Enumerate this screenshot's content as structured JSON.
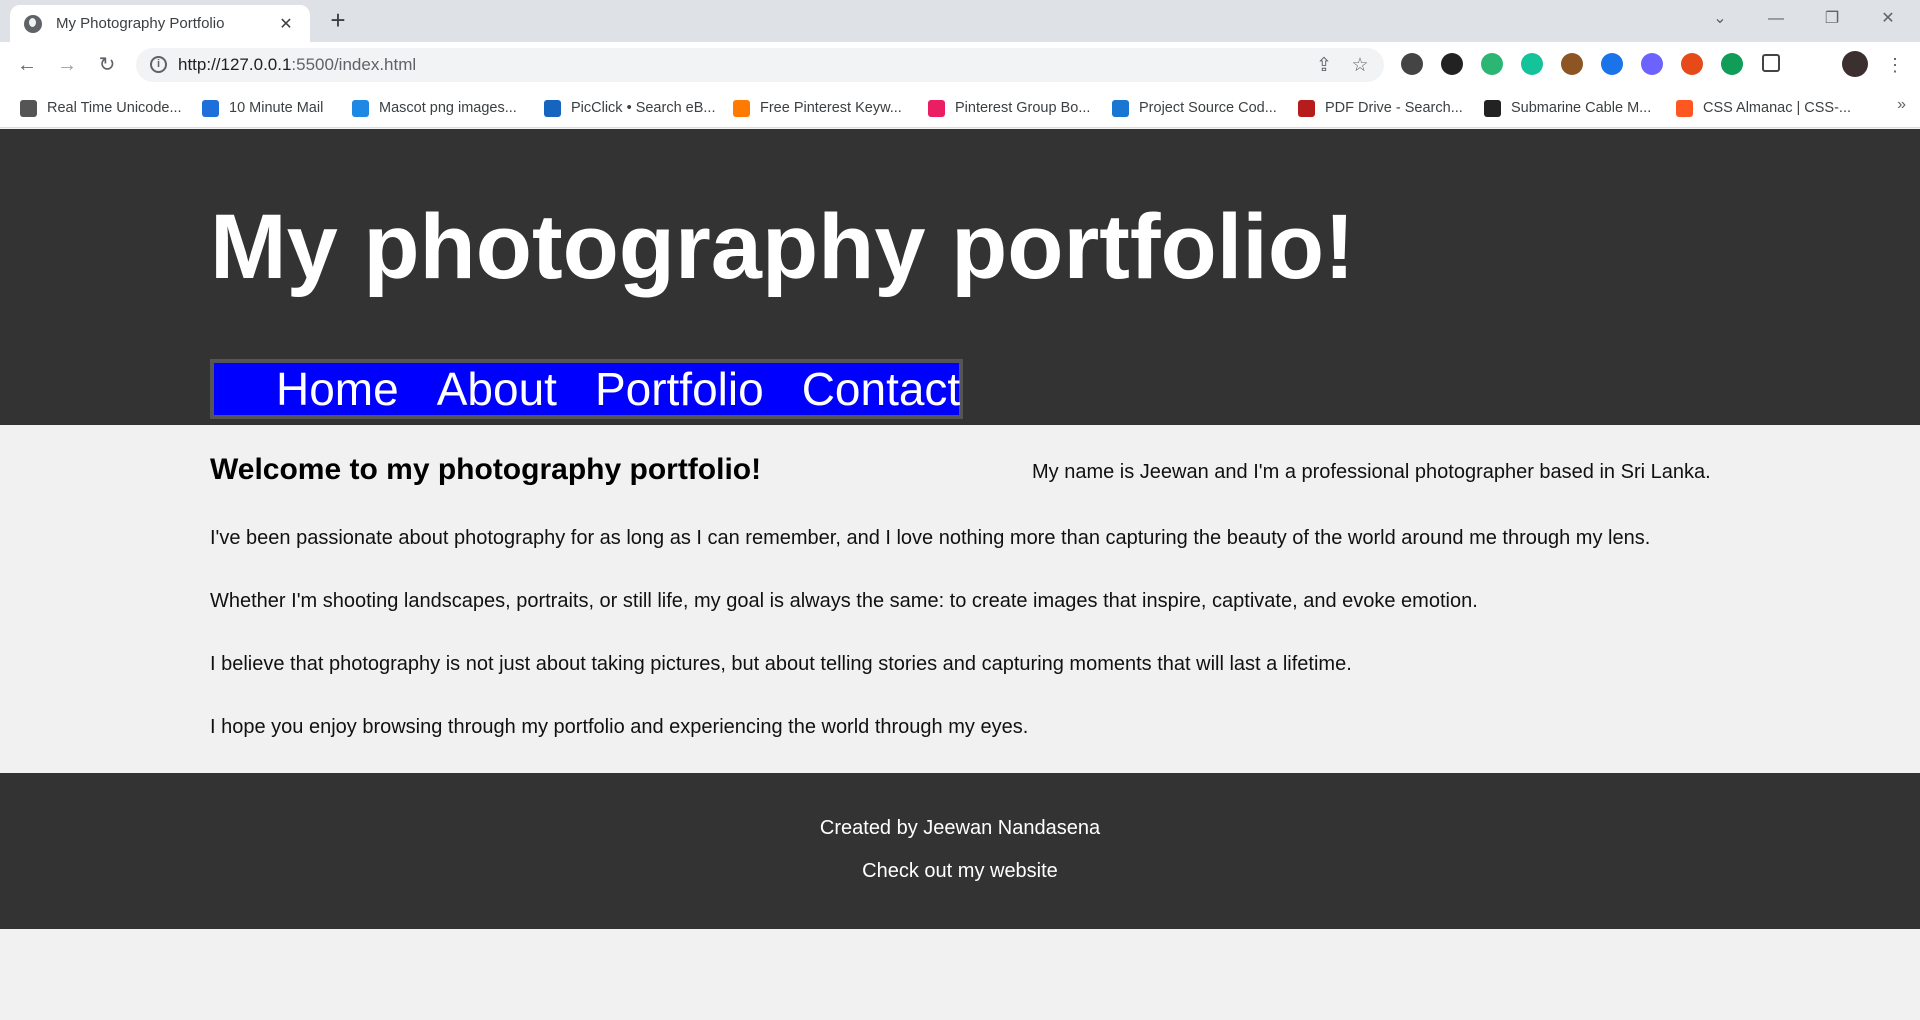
{
  "browser": {
    "tab_title": "My Photography Portfolio",
    "tab_close": "✕",
    "new_tab": "+",
    "url_host": "http://127.0.0.1",
    "url_rest": ":5500/index.html",
    "window_controls": [
      "⌄",
      "—",
      "❐",
      "✕"
    ],
    "bookmarks": [
      {
        "label": "Real Time Unicode...",
        "color": "#555555"
      },
      {
        "label": "10 Minute Mail",
        "color": "#1e6fd9"
      },
      {
        "label": "Mascot png images...",
        "color": "#1e88e5"
      },
      {
        "label": "PicClick • Search eB...",
        "color": "#1565c0"
      },
      {
        "label": "Free Pinterest Keyw...",
        "color": "#ff7a00"
      },
      {
        "label": "Pinterest Group Bo...",
        "color": "#e91e63"
      },
      {
        "label": "Project Source Cod...",
        "color": "#1976d2"
      },
      {
        "label": "PDF Drive - Search...",
        "color": "#b71c1c"
      },
      {
        "label": "Submarine Cable M...",
        "color": "#222222"
      },
      {
        "label": "CSS Almanac | CSS-...",
        "color": "#ff5722"
      }
    ],
    "bookmarks_more": "»",
    "extension_colors": [
      "#444444",
      "#222222",
      "#2bb673",
      "#15c39a",
      "#8d5524",
      "#1a73e8",
      "#6c63ff",
      "#e64a19",
      "#0f9d58"
    ]
  },
  "site": {
    "title": "My photography portfolio!",
    "nav": [
      "Home",
      "About",
      "Portfolio",
      "Contact"
    ],
    "heading": "Welcome to my photography portfolio!",
    "intro": "My name is Jeewan and I'm a professional photographer based in Sri Lanka.",
    "paragraphs": [
      "I've been passionate about photography for as long as I can remember, and I love nothing more than capturing the beauty of the world around me through my lens.",
      "Whether I'm shooting landscapes, portraits, or still life, my goal is always the same: to create images that inspire, captivate, and evoke emotion.",
      "I believe that photography is not just about taking pictures, but about telling stories and capturing moments that will last a lifetime.",
      "I hope you enjoy browsing through my portfolio and experiencing the world through my eyes."
    ],
    "footer": {
      "created_by": "Created by Jeewan Nandasena",
      "link": "Check out my website"
    }
  }
}
